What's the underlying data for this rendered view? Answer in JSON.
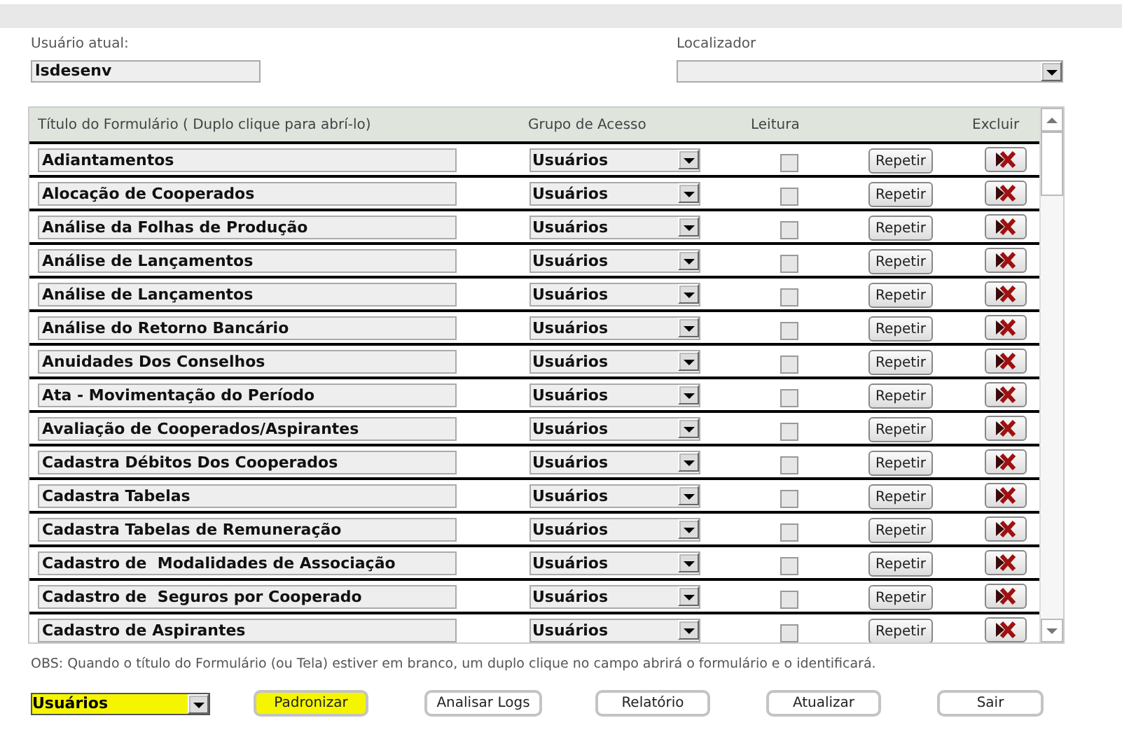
{
  "current_user": {
    "label": "Usuário atual:",
    "value": "lsdesenv"
  },
  "locator": {
    "label": "Localizador"
  },
  "table": {
    "columns": [
      "Título do Formulário ( Duplo clique para abrí-lo)",
      "Grupo de Acesso",
      "Leitura",
      "Excluir"
    ],
    "rows": [
      {
        "title": "Adiantamentos",
        "group": "Usuários",
        "read": false,
        "repeat": "Repetir"
      },
      {
        "title": "Alocação de Cooperados",
        "group": "Usuários",
        "read": false,
        "repeat": "Repetir"
      },
      {
        "title": "Análise da Folhas de Produção",
        "group": "Usuários",
        "read": false,
        "repeat": "Repetir"
      },
      {
        "title": "Análise de Lançamentos",
        "group": "Usuários",
        "read": false,
        "repeat": "Repetir"
      },
      {
        "title": "Análise de Lançamentos",
        "group": "Usuários",
        "read": false,
        "repeat": "Repetir"
      },
      {
        "title": "Análise do Retorno Bancário",
        "group": "Usuários",
        "read": false,
        "repeat": "Repetir"
      },
      {
        "title": "Anuidades Dos Conselhos",
        "group": "Usuários",
        "read": false,
        "repeat": "Repetir"
      },
      {
        "title": "Ata - Movimentação do Período",
        "group": "Usuários",
        "read": false,
        "repeat": "Repetir"
      },
      {
        "title": "Avaliação de Cooperados/Aspirantes",
        "group": "Usuários",
        "read": false,
        "repeat": "Repetir"
      },
      {
        "title": "Cadastra Débitos Dos Cooperados",
        "group": "Usuários",
        "read": false,
        "repeat": "Repetir"
      },
      {
        "title": "Cadastra Tabelas",
        "group": "Usuários",
        "read": false,
        "repeat": "Repetir"
      },
      {
        "title": "Cadastra Tabelas de Remuneração",
        "group": "Usuários",
        "read": false,
        "repeat": "Repetir"
      },
      {
        "title": "Cadastro de  Modalidades de Associação",
        "group": "Usuários",
        "read": false,
        "repeat": "Repetir"
      },
      {
        "title": "Cadastro de  Seguros por Cooperado",
        "group": "Usuários",
        "read": false,
        "repeat": "Repetir"
      },
      {
        "title": "Cadastro de Aspirantes",
        "group": "Usuários",
        "read": false,
        "repeat": "Repetir"
      }
    ]
  },
  "note": "OBS: Quando o título do Formulário (ou Tela) estiver em branco, um duplo clique no campo abrirá o formulário e o identificará.",
  "group_select": {
    "value": "Usuários",
    "highlighted": true
  },
  "buttons": [
    {
      "label": "Padronizar",
      "highlighted": true
    },
    {
      "label": "Analisar Logs",
      "highlighted": false
    },
    {
      "label": "Relatório",
      "highlighted": false
    },
    {
      "label": "Atualizar",
      "highlighted": false
    },
    {
      "label": "Sair",
      "highlighted": false
    }
  ]
}
